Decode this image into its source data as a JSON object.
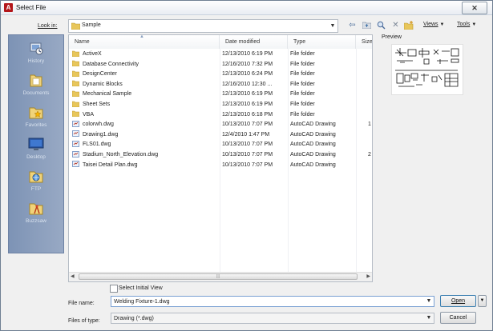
{
  "window": {
    "title": "Select File",
    "app_icon": "A",
    "close_label": "✕"
  },
  "toolbar": {
    "look_in_label": "Look in:",
    "look_in_value": "Sample",
    "views_label": "Views",
    "tools_label": "Tools"
  },
  "places": [
    {
      "label": "History",
      "icon": "history-icon"
    },
    {
      "label": "Documents",
      "icon": "documents-icon"
    },
    {
      "label": "Favorites",
      "icon": "favorites-icon"
    },
    {
      "label": "Desktop",
      "icon": "desktop-icon"
    },
    {
      "label": "FTP",
      "icon": "ftp-icon"
    },
    {
      "label": "Buzzsaw",
      "icon": "buzzsaw-icon"
    }
  ],
  "columns": {
    "name": "Name",
    "date": "Date modified",
    "type": "Type",
    "size": "Size"
  },
  "files": [
    {
      "name": "ActiveX",
      "date": "12/13/2010 6:19 PM",
      "type": "File folder",
      "size": "",
      "kind": "folder"
    },
    {
      "name": "Database Connectivity",
      "date": "12/16/2010 7:32 PM",
      "type": "File folder",
      "size": "",
      "kind": "folder"
    },
    {
      "name": "DesignCenter",
      "date": "12/13/2010 6:24 PM",
      "type": "File folder",
      "size": "",
      "kind": "folder"
    },
    {
      "name": "Dynamic Blocks",
      "date": "12/16/2010 12:30 ...",
      "type": "File folder",
      "size": "",
      "kind": "folder"
    },
    {
      "name": "Mechanical Sample",
      "date": "12/13/2010 6:19 PM",
      "type": "File folder",
      "size": "",
      "kind": "folder"
    },
    {
      "name": "Sheet Sets",
      "date": "12/13/2010 6:19 PM",
      "type": "File folder",
      "size": "",
      "kind": "folder"
    },
    {
      "name": "VBA",
      "date": "12/13/2010 6:18 PM",
      "type": "File folder",
      "size": "",
      "kind": "folder"
    },
    {
      "name": "colorwh.dwg",
      "date": "10/13/2010 7:07 PM",
      "type": "AutoCAD Drawing",
      "size": "1",
      "kind": "dwg"
    },
    {
      "name": "Drawing1.dwg",
      "date": "12/4/2010 1:47 PM",
      "type": "AutoCAD Drawing",
      "size": "",
      "kind": "dwg"
    },
    {
      "name": "FLS01.dwg",
      "date": "10/13/2010 7:07 PM",
      "type": "AutoCAD Drawing",
      "size": "",
      "kind": "dwg"
    },
    {
      "name": "Stadium_North_Elevation.dwg",
      "date": "10/13/2010 7:07 PM",
      "type": "AutoCAD Drawing",
      "size": "2",
      "kind": "dwg"
    },
    {
      "name": "Taisei Detail Plan.dwg",
      "date": "10/13/2010 7:07 PM",
      "type": "AutoCAD Drawing",
      "size": "",
      "kind": "dwg"
    }
  ],
  "preview": {
    "label": "Preview"
  },
  "options": {
    "select_initial_view": "Select Initial View"
  },
  "file_name": {
    "label": "File name:",
    "value": "Welding Fixture-1.dwg"
  },
  "file_type": {
    "label": "Files of type:",
    "value": "Drawing (*.dwg)"
  },
  "buttons": {
    "open": "Open",
    "cancel": "Cancel"
  },
  "colors": {
    "places_bg": "#8499ba",
    "folder": "#e8c65a",
    "accent": "#3c7fb1"
  }
}
